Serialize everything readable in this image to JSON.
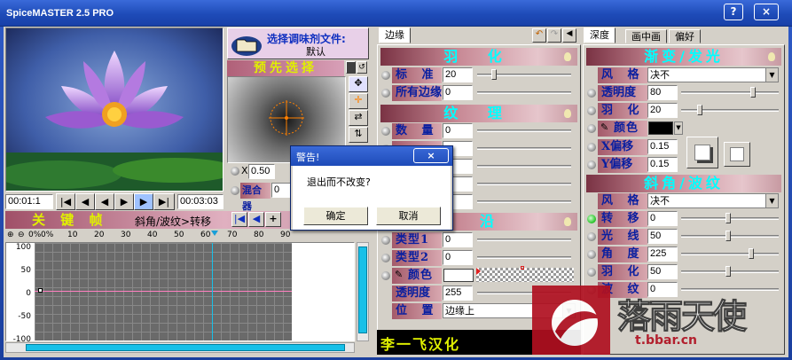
{
  "app": {
    "title": "SpiceMASTER 2.5 PRO",
    "help": "?",
    "close": "×"
  },
  "preview": {
    "time_start": "00:01:1",
    "time_end": "00:03:03",
    "transport": [
      "|◀",
      "◀",
      "◀",
      "▶",
      "▶",
      "▶|"
    ]
  },
  "select": {
    "title": "选择调味剂文件:",
    "value": "默认",
    "preselect": "预先选择"
  },
  "grad": {
    "x_label": "X",
    "x_value": "0.50",
    "mix_label": "混合器",
    "mix_value": "0"
  },
  "keyframes": {
    "title": "关 键 帧",
    "path": "斜角/波纹>转移",
    "zoom": "0%",
    "ticks": [
      "0%",
      "10",
      "20",
      "30",
      "40",
      "50",
      "60",
      "70",
      "80",
      "90"
    ],
    "yticks": [
      "100",
      "50",
      "0",
      "-50",
      "-100"
    ]
  },
  "edge": {
    "tab": "边缘",
    "s1": "羽 化",
    "standard_label": "标 准",
    "standard_value": "20",
    "all_label": "所有边缘",
    "all_value": "0",
    "s2": "纹 理",
    "count_label": "数 量",
    "count_value": "0",
    "s3": "沿",
    "type1_label": "类型1",
    "type1_value": "0",
    "type2_label": "类型2",
    "type2_value": "0",
    "color_label": "颜色",
    "opacity_label": "透明度",
    "opacity_value": "255",
    "pos_label": "位 置",
    "pos_value": "边缘上"
  },
  "right": {
    "tabs": [
      "深度",
      "画中画",
      "偏好"
    ],
    "s1": "渐变/发光",
    "style_label": "风 格",
    "style_value": "决不",
    "opacity_label": "透明度",
    "opacity_value": "80",
    "feather_label": "羽 化",
    "feather_value": "20",
    "color_label": "颜色",
    "xoff_label": "X偏移",
    "xoff_value": "0.15",
    "yoff_label": "Y偏移",
    "yoff_value": "0.15",
    "s2": "斜角/波纹",
    "style2_label": "风 格",
    "style2_value": "决不",
    "shift_label": "转 移",
    "shift_value": "0",
    "light_label": "光 线",
    "light_value": "50",
    "angle_label": "角 度",
    "angle_value": "225",
    "feather2_label": "羽 化",
    "feather2_value": "50",
    "wave_label": "波 纹",
    "wave_value": "0"
  },
  "credit": "李一飞汉化",
  "watermark": {
    "logo": "落雨天使",
    "url": "t.bbar.cn"
  },
  "dialog": {
    "title": "警告!",
    "message": "退出而不改变?",
    "ok": "确定",
    "cancel": "取消",
    "close": "×"
  }
}
